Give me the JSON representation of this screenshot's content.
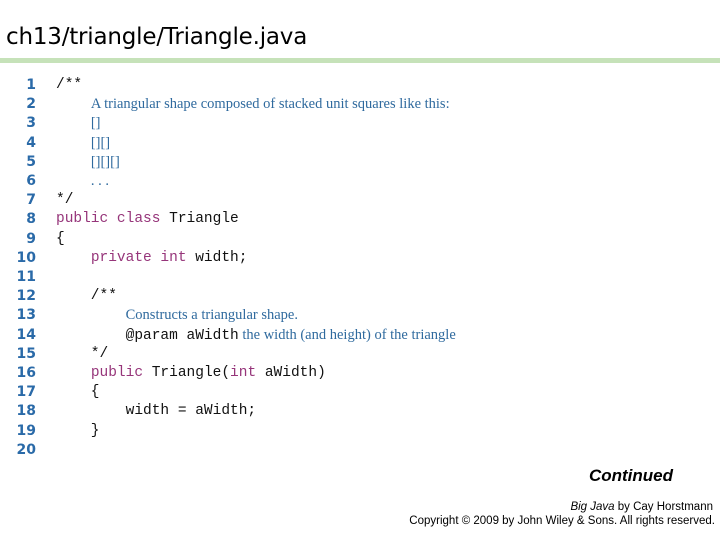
{
  "header": {
    "title": "ch13/triangle/Triangle.java",
    "accent_color": "#c6e2b9"
  },
  "code": {
    "line_numbers": [
      "1",
      "2",
      "3",
      "4",
      "5",
      "6",
      "7",
      "8",
      "9",
      "10",
      "11",
      "12",
      "13",
      "14",
      "15",
      "16",
      "17",
      "18",
      "19",
      "20"
    ],
    "lines": [
      [
        {
          "t": "/**",
          "c": "plain"
        }
      ],
      [
        {
          "t": "    ",
          "c": "plain"
        },
        {
          "t": "A triangular shape composed of stacked unit squares like this:",
          "c": "cmt"
        }
      ],
      [
        {
          "t": "    ",
          "c": "plain"
        },
        {
          "t": "[]",
          "c": "cmt"
        }
      ],
      [
        {
          "t": "    ",
          "c": "plain"
        },
        {
          "t": "[][]",
          "c": "cmt"
        }
      ],
      [
        {
          "t": "    ",
          "c": "plain"
        },
        {
          "t": "[][][]",
          "c": "cmt"
        }
      ],
      [
        {
          "t": "    ",
          "c": "plain"
        },
        {
          "t": ". . .",
          "c": "cmt"
        }
      ],
      [
        {
          "t": "*/",
          "c": "plain"
        }
      ],
      [
        {
          "t": "public class",
          "c": "kw"
        },
        {
          "t": " Triangle",
          "c": "plain"
        }
      ],
      [
        {
          "t": "{",
          "c": "plain"
        }
      ],
      [
        {
          "t": "    ",
          "c": "plain"
        },
        {
          "t": "private int",
          "c": "kw"
        },
        {
          "t": " width;",
          "c": "plain"
        }
      ],
      [],
      [
        {
          "t": "    /**",
          "c": "plain"
        }
      ],
      [
        {
          "t": "        ",
          "c": "plain"
        },
        {
          "t": "Constructs a triangular shape.",
          "c": "cmt"
        }
      ],
      [
        {
          "t": "        @param aWidth",
          "c": "plain"
        },
        {
          "t": " the width (and height) of the triangle",
          "c": "cmt"
        }
      ],
      [
        {
          "t": "    */",
          "c": "plain"
        }
      ],
      [
        {
          "t": "    ",
          "c": "plain"
        },
        {
          "t": "public",
          "c": "kw"
        },
        {
          "t": " Triangle(",
          "c": "plain"
        },
        {
          "t": "int",
          "c": "kw"
        },
        {
          "t": " aWidth)",
          "c": "plain"
        }
      ],
      [
        {
          "t": "    {",
          "c": "plain"
        }
      ],
      [
        {
          "t": "        width = aWidth;",
          "c": "plain"
        }
      ],
      [
        {
          "t": "    }",
          "c": "plain"
        }
      ],
      []
    ],
    "colors": {
      "line_number": "#2a6aa8",
      "keyword": "#96357a",
      "comment": "#2f6a9e",
      "plain": "#111111"
    }
  },
  "footer": {
    "continued": "Continued",
    "book_title": "Big Java",
    "book_author": " by Cay Horstmann",
    "copyright": "Copyright © 2009 by John Wiley & Sons.  All rights reserved."
  }
}
